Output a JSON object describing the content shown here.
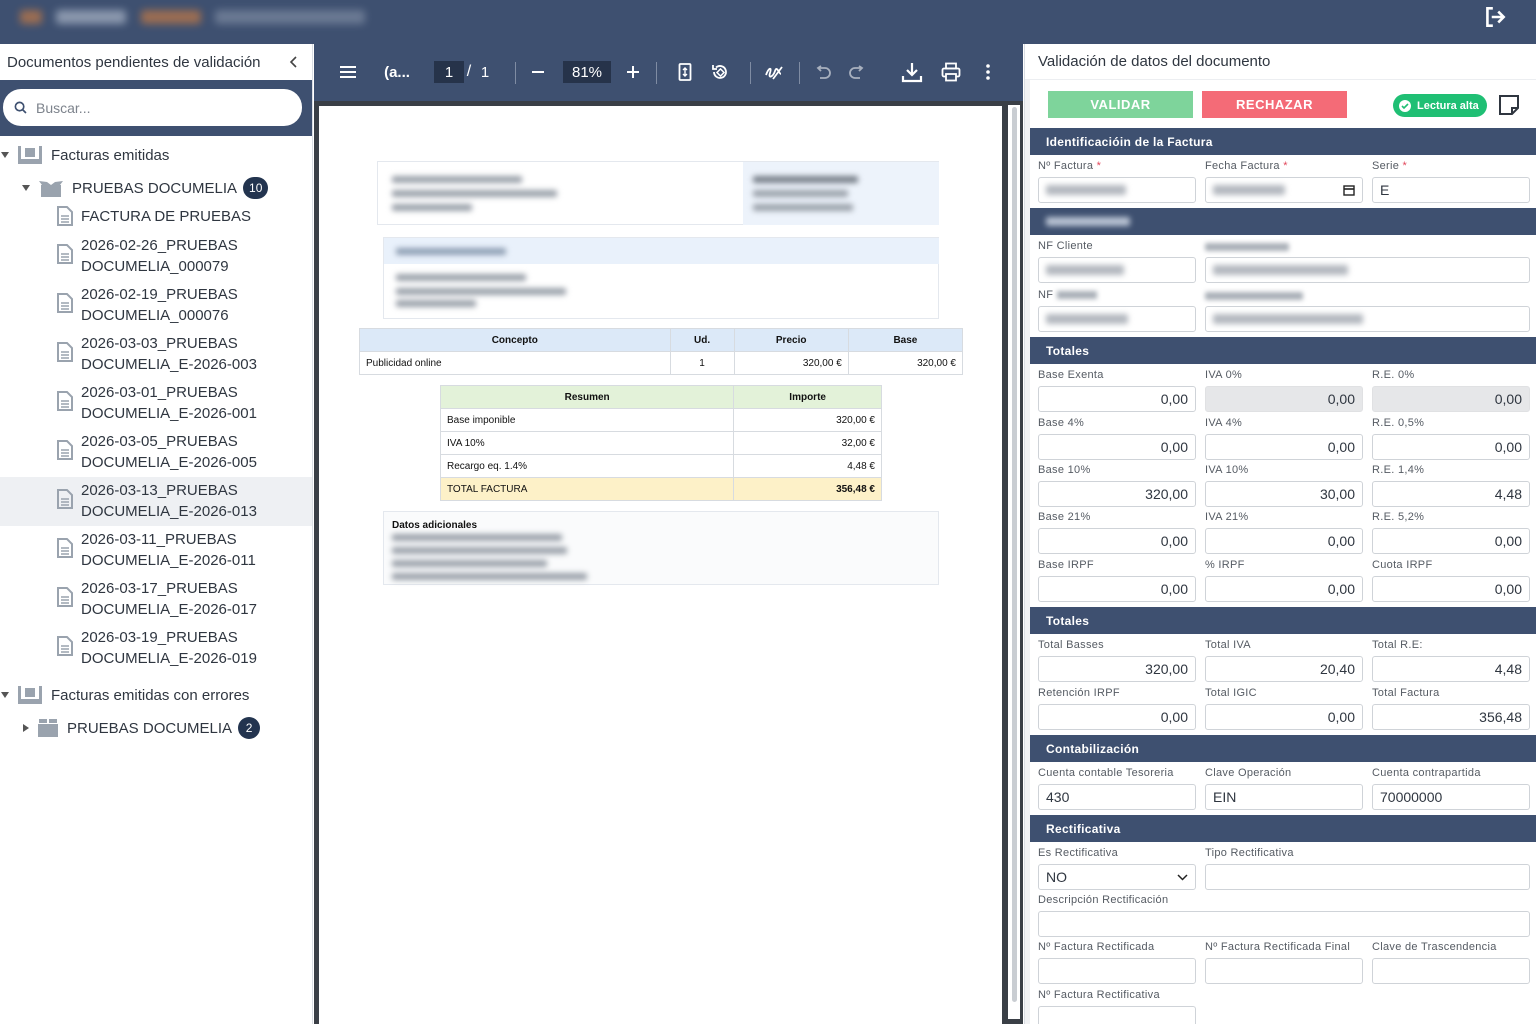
{
  "left": {
    "title": "Documentos pendientes de validación",
    "search_placeholder": "Buscar...",
    "groups": [
      {
        "label": "Facturas emitidas"
      },
      {
        "label": "PRUEBAS DOCUMELIA",
        "count": "10"
      },
      {
        "label": "Facturas emitidas con errores"
      },
      {
        "label": "PRUEBAS DOCUMELIA",
        "count": "2"
      }
    ],
    "docs": [
      {
        "line1": "FACTURA DE PRUEBAS",
        "line2": ""
      },
      {
        "line1": "2026-02-26_PRUEBAS",
        "line2": "DOCUMELIA_000079"
      },
      {
        "line1": "2026-02-19_PRUEBAS",
        "line2": "DOCUMELIA_000076"
      },
      {
        "line1": "2026-03-03_PRUEBAS",
        "line2": "DOCUMELIA_E-2026-003"
      },
      {
        "line1": "2026-03-01_PRUEBAS",
        "line2": "DOCUMELIA_E-2026-001"
      },
      {
        "line1": "2026-03-05_PRUEBAS",
        "line2": "DOCUMELIA_E-2026-005"
      },
      {
        "line1": "2026-03-13_PRUEBAS",
        "line2": "DOCUMELIA_E-2026-013"
      },
      {
        "line1": "2026-03-11_PRUEBAS",
        "line2": "DOCUMELIA_E-2026-011"
      },
      {
        "line1": "2026-03-17_PRUEBAS",
        "line2": "DOCUMELIA_E-2026-017"
      },
      {
        "line1": "2026-03-19_PRUEBAS",
        "line2": "DOCUMELIA_E-2026-019"
      }
    ]
  },
  "viewer": {
    "doc_title": "(a...",
    "page_current": "1",
    "page_sep": "/",
    "page_total": "1",
    "zoom": "81%",
    "pdf": {
      "items_headers": [
        "Concepto",
        "Ud.",
        "Precio",
        "Base"
      ],
      "items_row": [
        "Publicidad online",
        "1",
        "320,00 €",
        "320,00 €"
      ],
      "summary_headers": [
        "Resumen",
        "Importe"
      ],
      "summary_rows": [
        [
          "Base imponible",
          "320,00 €"
        ],
        [
          "IVA 10%",
          "32,00 €"
        ],
        [
          "Recargo eq. 1.4%",
          "4,48 €"
        ],
        [
          "TOTAL FACTURA",
          "356,48 €"
        ]
      ],
      "extra_title": "Datos adicionales"
    }
  },
  "right": {
    "title": "Validación de datos del documento",
    "btn_validar": "VALIDAR",
    "btn_rechazar": "RECHAZAR",
    "btn_lectura": "Lectura alta",
    "sections": {
      "identificacion": "Identificacióin de la Factura",
      "totales1": "Totales",
      "totales2": "Totales",
      "contabilizacion": "Contabilización",
      "rectificativa": "Rectificativa"
    },
    "labels": {
      "num_factura": "Nº Factura",
      "fecha_factura": "Fecha Factura",
      "serie": "Serie",
      "nf_cliente": "NF Cliente",
      "nf": "NF",
      "base_exenta": "Base Exenta",
      "iva_0": "IVA 0%",
      "re_0": "R.E. 0%",
      "base_4": "Base 4%",
      "iva_4": "IVA 4%",
      "re_05": "R.E. 0,5%",
      "base_10": "Base 10%",
      "iva_10": "IVA 10%",
      "re_14": "R.E. 1,4%",
      "base_21": "Base 21%",
      "iva_21": "IVA 21%",
      "re_52": "R.E. 5,2%",
      "base_irpf": "Base IRPF",
      "pct_irpf": "% IRPF",
      "cuota_irpf": "Cuota IRPF",
      "total_basses": "Total Basses",
      "total_iva": "Total IVA",
      "total_re": "Total R.E:",
      "retencion_irpf": "Retención IRPF",
      "total_igic": "Total IGIC",
      "total_factura": "Total Factura",
      "cuenta_tesoreria": "Cuenta contable Tesoreria",
      "clave_operacion": "Clave Operación",
      "cuenta_contrapartida": "Cuenta contrapartida",
      "es_rectificativa": "Es Rectificativa",
      "tipo_rectificativa": "Tipo Rectificativa",
      "descripcion_rectificacion": "Descripción Rectificación",
      "nf_rectificada": "Nº Factura Rectificada",
      "nf_rectificada_final": "Nº Factura Rectificada Final",
      "clave_trascendencia": "Clave de Trascendencia",
      "nf_rectificativa": "Nº Factura Rectificativa"
    },
    "values": {
      "serie": "E",
      "base_exenta": "0,00",
      "iva_0": "0,00",
      "re_0": "0,00",
      "base_4": "0,00",
      "iva_4": "0,00",
      "re_05": "0,00",
      "base_10": "320,00",
      "iva_10": "30,00",
      "re_14": "4,48",
      "base_21": "0,00",
      "iva_21": "0,00",
      "re_52": "0,00",
      "base_irpf": "0,00",
      "pct_irpf": "0,00",
      "cuota_irpf": "0,00",
      "total_basses": "320,00",
      "total_iva": "20,40",
      "total_re": "4,48",
      "retencion_irpf": "0,00",
      "total_igic": "0,00",
      "total_factura": "356,48",
      "cuenta_tesoreria": "430",
      "clave_operacion": "EIN",
      "cuenta_contrapartida": "70000000",
      "es_rectificativa": "NO"
    },
    "required_mark": "*"
  },
  "colors": {
    "header": "#3e5070",
    "validar": "#7ed49b",
    "rechazar": "#f46b77",
    "lectura": "#1fbf74",
    "badge": "#23344f"
  }
}
